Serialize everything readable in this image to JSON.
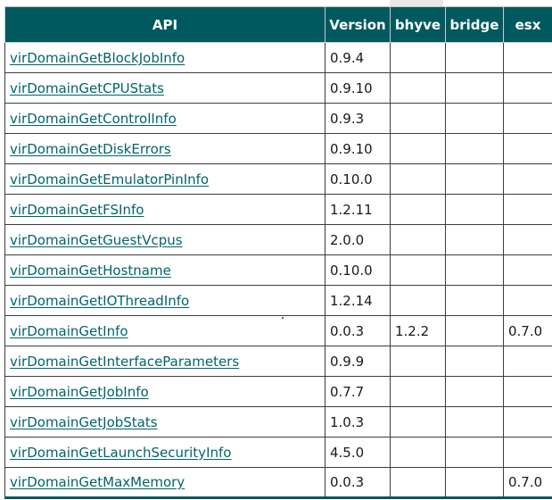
{
  "table": {
    "headers": [
      "API",
      "Version",
      "bhyve",
      "bridge",
      "esx"
    ],
    "rows": [
      {
        "api": "virDomainGetBlockJobInfo",
        "version": "0.9.4",
        "bhyve": "",
        "bridge": "",
        "esx": ""
      },
      {
        "api": "virDomainGetCPUStats",
        "version": "0.9.10",
        "bhyve": "",
        "bridge": "",
        "esx": ""
      },
      {
        "api": "virDomainGetControlInfo",
        "version": "0.9.3",
        "bhyve": "",
        "bridge": "",
        "esx": ""
      },
      {
        "api": "virDomainGetDiskErrors",
        "version": "0.9.10",
        "bhyve": "",
        "bridge": "",
        "esx": ""
      },
      {
        "api": "virDomainGetEmulatorPinInfo",
        "version": "0.10.0",
        "bhyve": "",
        "bridge": "",
        "esx": ""
      },
      {
        "api": "virDomainGetFSInfo",
        "version": "1.2.11",
        "bhyve": "",
        "bridge": "",
        "esx": ""
      },
      {
        "api": "virDomainGetGuestVcpus",
        "version": "2.0.0",
        "bhyve": "",
        "bridge": "",
        "esx": ""
      },
      {
        "api": "virDomainGetHostname",
        "version": "0.10.0",
        "bhyve": "",
        "bridge": "",
        "esx": ""
      },
      {
        "api": "virDomainGetIOThreadInfo",
        "version": "1.2.14",
        "bhyve": "",
        "bridge": "",
        "esx": ""
      },
      {
        "api": "virDomainGetInfo",
        "version": "0.0.3",
        "bhyve": "1.2.2",
        "bridge": "",
        "esx": "0.7.0"
      },
      {
        "api": "virDomainGetInterfaceParameters",
        "version": "0.9.9",
        "bhyve": "",
        "bridge": "",
        "esx": ""
      },
      {
        "api": "virDomainGetJobInfo",
        "version": "0.7.7",
        "bhyve": "",
        "bridge": "",
        "esx": ""
      },
      {
        "api": "virDomainGetJobStats",
        "version": "1.0.3",
        "bhyve": "",
        "bridge": "",
        "esx": ""
      },
      {
        "api": "virDomainGetLaunchSecurityInfo",
        "version": "4.5.0",
        "bhyve": "",
        "bridge": "",
        "esx": ""
      },
      {
        "api": "virDomainGetMaxMemory",
        "version": "0.0.3",
        "bhyve": "",
        "bridge": "",
        "esx": "0.7.0"
      }
    ]
  },
  "colors": {
    "header_bg": "#005a5d",
    "link": "#00656a"
  }
}
